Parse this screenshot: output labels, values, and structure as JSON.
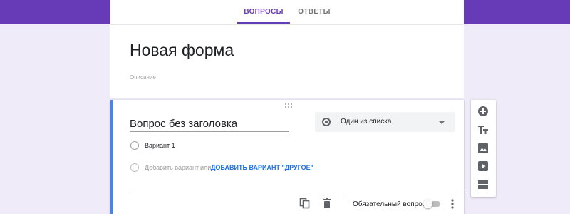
{
  "header": {
    "tabs": [
      {
        "label": "ВОПРОСЫ",
        "active": true
      },
      {
        "label": "ОТВЕТЫ",
        "active": false
      }
    ],
    "accent_color": "#673ab7"
  },
  "form": {
    "title": "Новая форма",
    "description_placeholder": "Описание"
  },
  "question": {
    "title": "Вопрос без заголовка",
    "type": "Один из списка",
    "options": [
      {
        "label": "Вариант 1"
      }
    ],
    "add_option": "Добавить вариант",
    "or": "или",
    "add_other": "ДОБАВИТЬ ВАРИАНТ \"ДРУГОЕ\"",
    "required_label": "Обязательный вопрос",
    "required": false,
    "footer_icons": [
      "copy-icon",
      "delete-icon",
      "more-vert-icon"
    ]
  },
  "toolbar": {
    "icons": [
      "add-circle-icon",
      "title-icon",
      "image-icon",
      "video-icon",
      "section-icon"
    ]
  }
}
